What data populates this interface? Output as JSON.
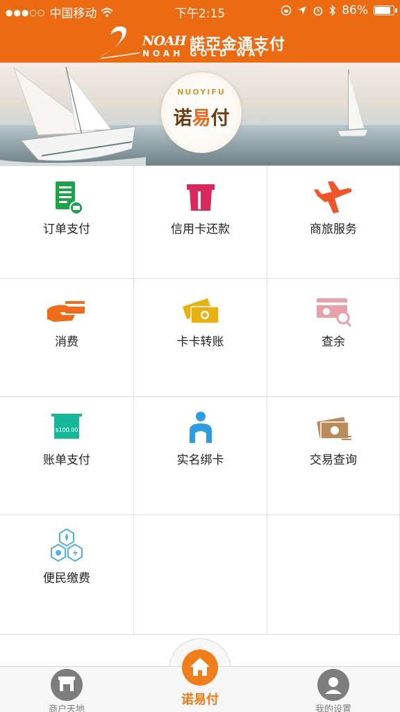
{
  "status_bar": {
    "carrier": "中国移动",
    "time": "下午2:15",
    "battery": "86%",
    "battery_level": 0.86
  },
  "header": {
    "logo_en": "NOAH",
    "logo_cn": "諾亞金通支付",
    "logo_sub": "NOAH GOLD WAY"
  },
  "banner": {
    "badge_pinyin": "NUOYIFU",
    "badge_name": "诺易付"
  },
  "menu": [
    {
      "label": "订单支付",
      "icon": "order-doc-icon",
      "color": "#1fa34a"
    },
    {
      "label": "信用卡还款",
      "icon": "credit-card-icon",
      "color": "#d8285c"
    },
    {
      "label": "商旅服务",
      "icon": "airplane-icon",
      "color": "#f1552a"
    },
    {
      "label": "消费",
      "icon": "hand-card-icon",
      "color": "#ef6a1b"
    },
    {
      "label": "卡卡转账",
      "icon": "card-transfer-icon",
      "color": "#e9b10f"
    },
    {
      "label": "查余",
      "icon": "balance-search-icon",
      "color": "#e8a0a8"
    },
    {
      "label": "账单支付",
      "icon": "bill-icon",
      "color": "#17b89a",
      "amount": "$100.00"
    },
    {
      "label": "实名绑卡",
      "icon": "person-icon",
      "color": "#2f9ce0"
    },
    {
      "label": "交易查询",
      "icon": "money-query-icon",
      "color": "#b98a5a"
    },
    {
      "label": "便民缴费",
      "icon": "utilities-hex-icon",
      "color": "#52b0e6"
    }
  ],
  "tabs": {
    "merchant": "商户天地",
    "home": "诺易付",
    "settings": "我的设置"
  },
  "colors": {
    "brand": "#ec6a12",
    "tab_active": "#ec7a18",
    "tab_inactive": "#7d7d7d"
  }
}
